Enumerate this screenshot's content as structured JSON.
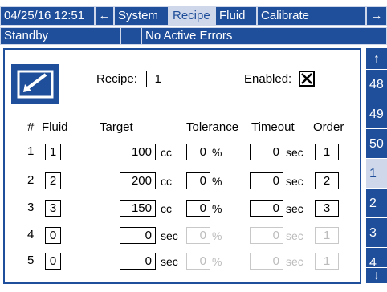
{
  "topbar": {
    "datetime": "04/25/16 12:51",
    "left_arrow": "←",
    "tabs": [
      "System",
      "Recipe",
      "Fluid",
      "Calibrate"
    ],
    "active_tab": "Recipe",
    "right_arrow": "→"
  },
  "statusbar": {
    "status": "Standby",
    "errors": "No Active Errors"
  },
  "recipe": {
    "recipe_label": "Recipe:",
    "recipe_value": "1",
    "enabled_label": "Enabled:",
    "enabled_checked": true
  },
  "table": {
    "headers": {
      "num": "#",
      "fluid": "Fluid",
      "target": "Target",
      "tolerance": "Tolerance",
      "timeout": "Timeout",
      "order": "Order"
    },
    "rows": [
      {
        "num": "1",
        "fluid": "1",
        "target": "100",
        "target_unit": "cc",
        "tolerance": "0",
        "tolerance_unit": "%",
        "timeout": "0",
        "timeout_unit": "sec",
        "order": "1",
        "enabled": true
      },
      {
        "num": "2",
        "fluid": "2",
        "target": "200",
        "target_unit": "cc",
        "tolerance": "0",
        "tolerance_unit": "%",
        "timeout": "0",
        "timeout_unit": "sec",
        "order": "2",
        "enabled": true
      },
      {
        "num": "3",
        "fluid": "3",
        "target": "150",
        "target_unit": "cc",
        "tolerance": "0",
        "tolerance_unit": "%",
        "timeout": "0",
        "timeout_unit": "sec",
        "order": "3",
        "enabled": true
      },
      {
        "num": "4",
        "fluid": "0",
        "target": "0",
        "target_unit": "sec",
        "tolerance": "0",
        "tolerance_unit": "%",
        "timeout": "0",
        "timeout_unit": "sec",
        "order": "1",
        "enabled": false
      },
      {
        "num": "5",
        "fluid": "0",
        "target": "0",
        "target_unit": "sec",
        "tolerance": "0",
        "tolerance_unit": "%",
        "timeout": "0",
        "timeout_unit": "sec",
        "order": "1",
        "enabled": false
      }
    ]
  },
  "sidebar": {
    "up_arrow": "↑",
    "down_arrow": "↓",
    "items": [
      "48",
      "49",
      "50",
      "1",
      "2",
      "3",
      "4"
    ],
    "selected": "1"
  },
  "colors": {
    "accent": "#1f4e9a",
    "selected": "#cfd8ea"
  }
}
